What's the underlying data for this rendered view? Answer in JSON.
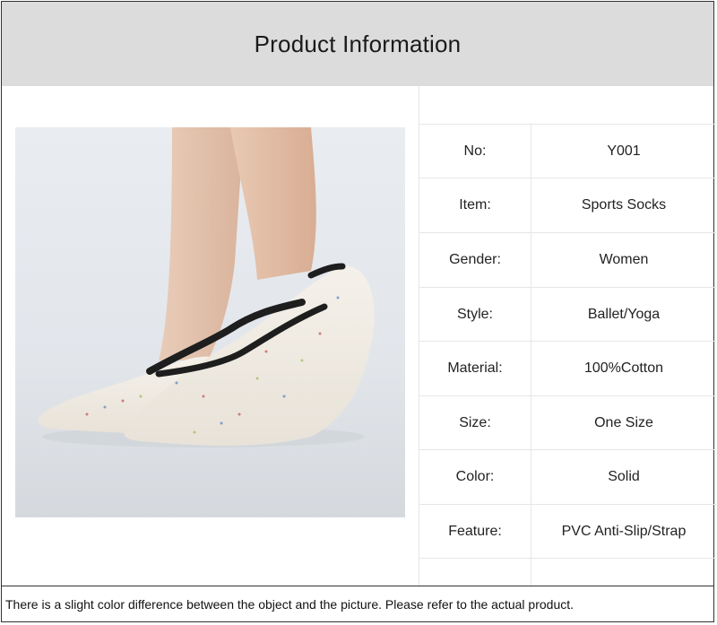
{
  "header": {
    "title": "Product Information"
  },
  "product_image": {
    "subject": "sock-photo"
  },
  "specs": [
    {
      "label": "No:",
      "value": "Y001"
    },
    {
      "label": "Item:",
      "value": "Sports Socks"
    },
    {
      "label": "Gender:",
      "value": "Women"
    },
    {
      "label": "Style:",
      "value": "Ballet/Yoga"
    },
    {
      "label": "Material:",
      "value": "100%Cotton"
    },
    {
      "label": "Size:",
      "value": "One Size"
    },
    {
      "label": "Color:",
      "value": "Solid"
    },
    {
      "label": "Feature:",
      "value": "PVC Anti-Slip/Strap"
    }
  ],
  "footer": {
    "note": "There is a slight color difference between the object and the picture. Please refer to the actual product."
  }
}
